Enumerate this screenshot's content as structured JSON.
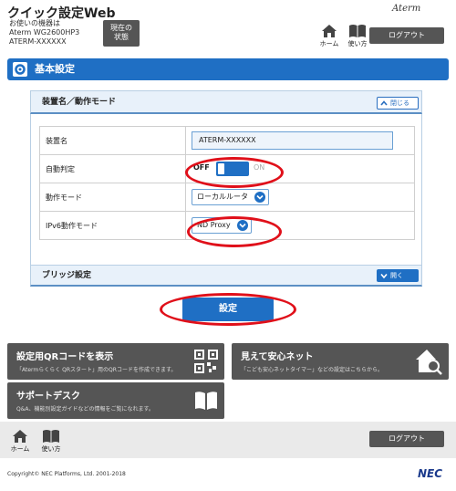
{
  "header": {
    "title": "クイック設定Web",
    "device_line1": "お使いの機器は",
    "device_line2": "Aterm WG2600HP3",
    "device_line3": "ATERM-XXXXXX",
    "status_button": "現在の\n状態",
    "brand": "Aterm",
    "home_label": "ホーム",
    "help_label": "使い方",
    "logout": "ログアウト"
  },
  "section": {
    "title": "基本設定"
  },
  "panel": {
    "title": "装置名／動作モード",
    "collapse_label": "閉じる",
    "rows": [
      {
        "label": "装置名",
        "value": "ATERM-XXXXXX"
      },
      {
        "label": "自動判定",
        "off": "OFF",
        "on": "ON"
      },
      {
        "label": "動作モード",
        "value": "ローカルルータ"
      },
      {
        "label": "IPv6動作モード",
        "value": "ND Proxy"
      }
    ]
  },
  "bridge": {
    "title": "ブリッジ設定",
    "expand_label": "開く"
  },
  "apply_button": "設定",
  "cards": {
    "qr": {
      "title": "設定用QRコードを表示",
      "desc": "「Atermらくらく QRスタート」用のQRコードを作成できます。"
    },
    "net": {
      "title": "見えて安心ネット",
      "desc": "「こども安心ネットタイマー」などの設定はこちらから。"
    },
    "support": {
      "title": "サポートデスク",
      "desc": "Q&A、機能別設定ガイドなどの情報をご覧になれます。"
    }
  },
  "footer": {
    "home_label": "ホーム",
    "help_label": "使い方",
    "logout": "ログアウト",
    "copyright": "Copyright© NEC Platforms, Ltd. 2001-2018",
    "nec": "NEC"
  },
  "colors": {
    "accent": "#1f6fc4",
    "annotation": "#e0101a",
    "dark_button": "#555555"
  }
}
